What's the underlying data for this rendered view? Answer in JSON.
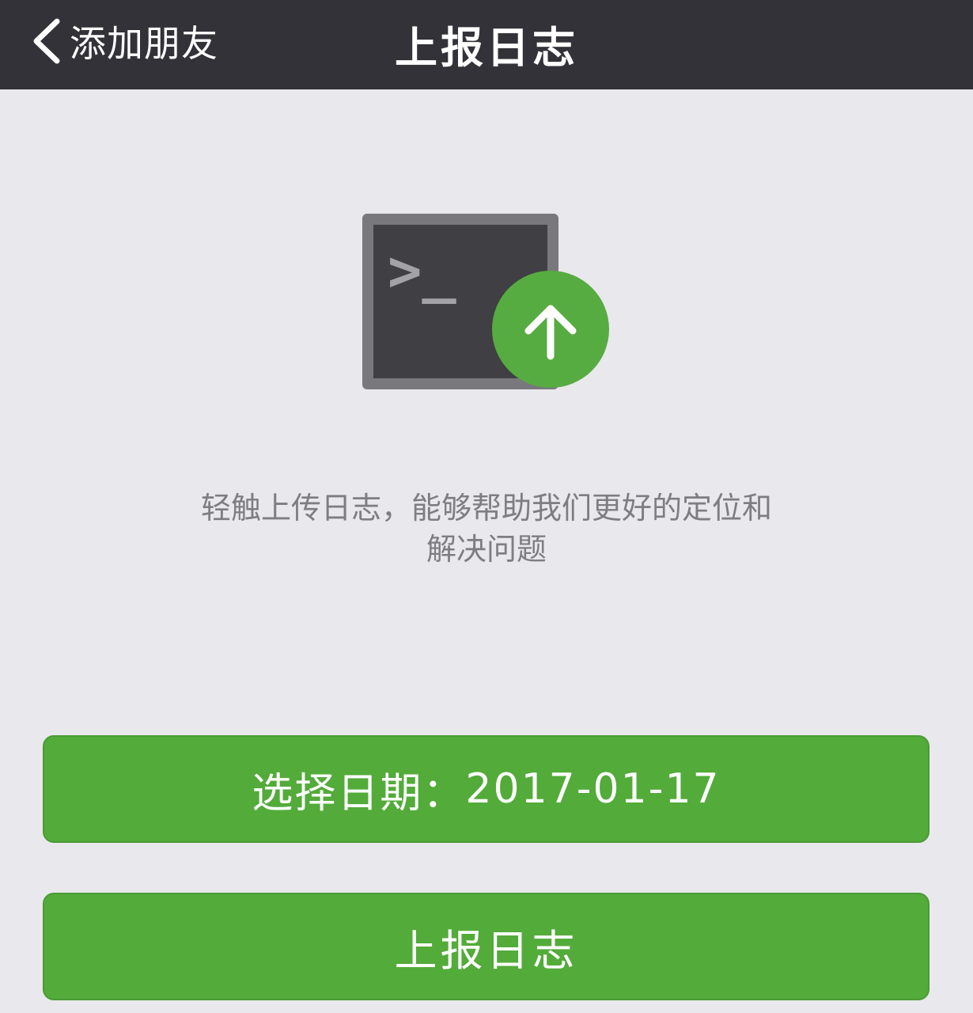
{
  "navbar": {
    "back_label": "添加朋友",
    "title": "上报日志",
    "back_icon": "chevron-left-icon"
  },
  "illustration": {
    "terminal_prompt": ">_",
    "icon": "terminal-upload-icon",
    "terminal_color": "#403f44",
    "badge_color": "#56ac40"
  },
  "description": {
    "line1": "轻触上传日志，能够帮助我们更好的定位和",
    "line2": "解决问题"
  },
  "buttons": {
    "select_date_label": "选择日期：",
    "selected_date": "2017-01-17",
    "upload_label": "上报日志"
  },
  "colors": {
    "navbar_bg": "#333238",
    "page_bg": "#e9e8ec",
    "button_green": "#53ab3a"
  }
}
